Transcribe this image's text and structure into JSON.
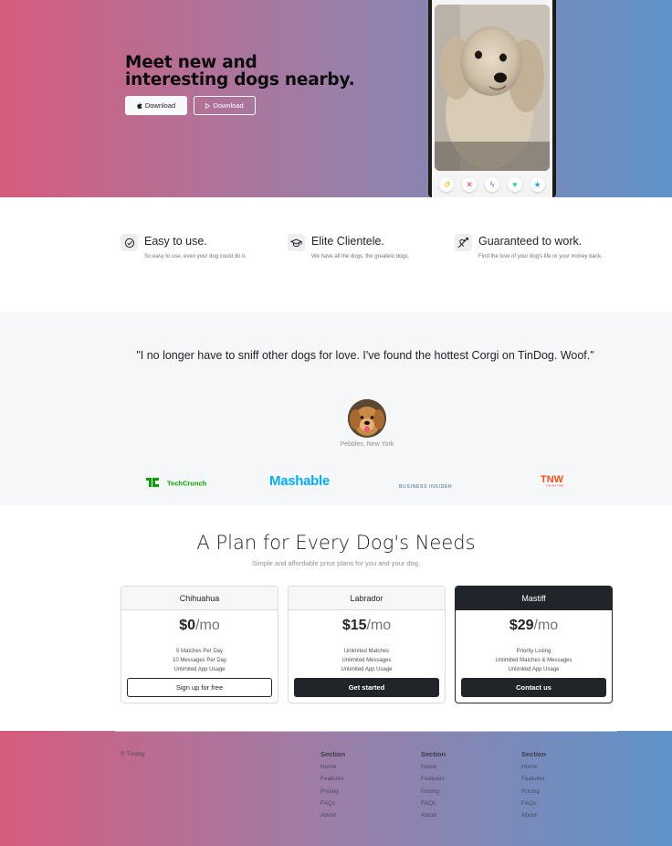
{
  "hero": {
    "headline": "Meet new and interesting dogs nearby.",
    "download_apple_label": "Download",
    "download_play_label": "Download",
    "gradient": [
      "#d65c7e",
      "#5e93c9"
    ]
  },
  "features": [
    {
      "title": "Easy to use.",
      "text": "So easy to use, even your dog could do it.",
      "icon": "check-circle-icon"
    },
    {
      "title": "Elite Clientele.",
      "text": "We have all the dogs, the greatest dogs.",
      "icon": "graduation-cap-icon"
    },
    {
      "title": "Guaranteed to work.",
      "text": "Find the love of your dog's life or your money back.",
      "icon": "heart-arrow-icon"
    }
  ],
  "testimonial": {
    "quote": "\"I no longer have to sniff other dogs for love. I've found the hottest Corgi on TinDog. Woof.\"",
    "cite": "Pebbles, New York"
  },
  "press": {
    "techcrunch": "TechCrunch",
    "mashable": "Mashable",
    "business_insider": "BUSINESS INSIDER",
    "tnw": "TNW",
    "tnw_sub": "THE NEXT WEB"
  },
  "pricing": {
    "title": "A Plan for Every Dog's Needs",
    "subtitle": "Simple and affordable price plans for you and your dog.",
    "plans": [
      {
        "name": "Chihuahua",
        "price": "$0",
        "per": "/mo",
        "features": [
          "5 Matches Per Day",
          "10 Messages Per Day",
          "Unlimited App Usage"
        ],
        "cta": "Sign up for free"
      },
      {
        "name": "Labrador",
        "price": "$15",
        "per": "/mo",
        "features": [
          "Unlimited Matches",
          "Unlimited Messages",
          "Unlimited App Usage"
        ],
        "cta": "Get started"
      },
      {
        "name": "Mastiff",
        "price": "$29",
        "per": "/mo",
        "features": [
          "Priority Listing",
          "Unlimited Matches & Messages",
          "Unlimited App Usage"
        ],
        "cta": "Contact us"
      }
    ]
  },
  "footer": {
    "copyright": "© Tindog",
    "columns": [
      {
        "heading": "Section",
        "links": [
          "Home",
          "Features",
          "Pricing",
          "FAQs",
          "About"
        ]
      },
      {
        "heading": "Section",
        "links": [
          "Home",
          "Features",
          "Pricing",
          "FAQs",
          "About"
        ]
      },
      {
        "heading": "Section",
        "links": [
          "Home",
          "Features",
          "Pricing",
          "FAQs",
          "About"
        ]
      }
    ]
  }
}
